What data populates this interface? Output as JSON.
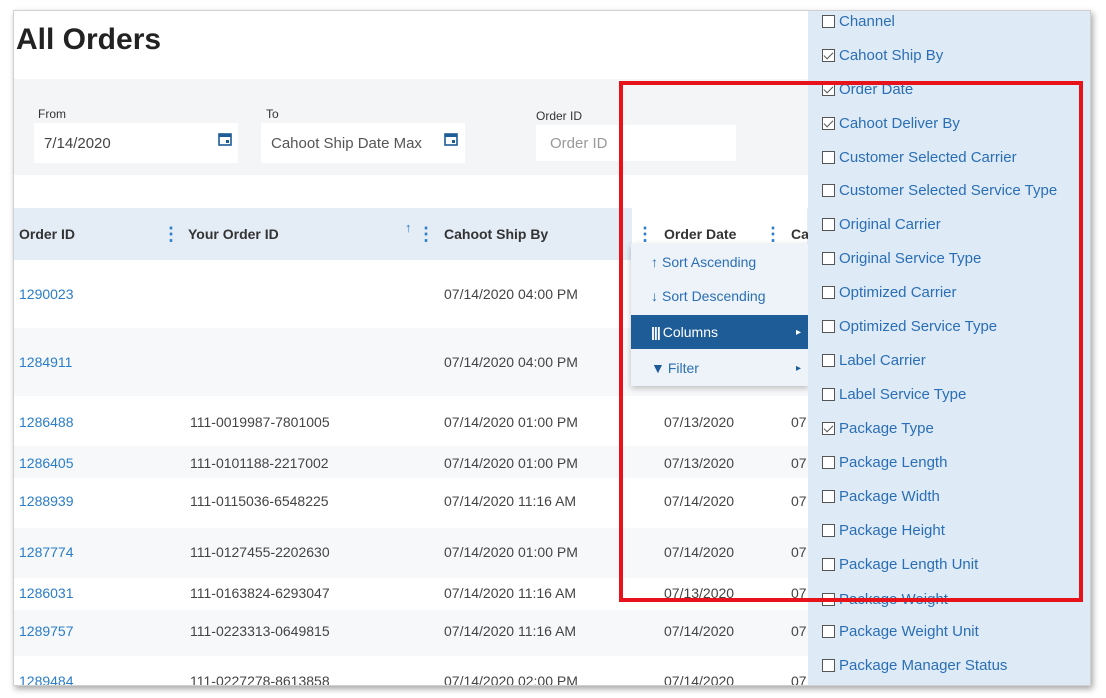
{
  "page": {
    "title": "All Orders"
  },
  "filters": {
    "from_label": "From",
    "from_value": "7/14/2020",
    "to_label": "To",
    "to_placeholder": "Cahoot Ship Date Max",
    "order_id_label": "Order ID",
    "order_id_placeholder": "Order ID"
  },
  "grid": {
    "headers": {
      "order_id": "Order ID",
      "your_order_id": "Your Order ID",
      "cahoot_ship_by": "Cahoot Ship By",
      "order_date": "Order Date",
      "next_partial": "Ca"
    },
    "sort_indicator": "↑",
    "rows": [
      {
        "order_id": "1290023",
        "your_order_id": "",
        "ship_by": "07/14/2020 04:00 PM",
        "order_date": "",
        "extra": ""
      },
      {
        "order_id": "1284911",
        "your_order_id": "",
        "ship_by": "07/14/2020 04:00 PM",
        "order_date": "",
        "extra": ""
      },
      {
        "order_id": "1286488",
        "your_order_id": "111-0019987-7801005",
        "ship_by": "07/14/2020 01:00 PM",
        "order_date": "07/13/2020",
        "extra": "07"
      },
      {
        "order_id": "1286405",
        "your_order_id": "111-0101188-2217002",
        "ship_by": "07/14/2020 01:00 PM",
        "order_date": "07/13/2020",
        "extra": "07"
      },
      {
        "order_id": "1288939",
        "your_order_id": "111-0115036-6548225",
        "ship_by": "07/14/2020 11:16 AM",
        "order_date": "07/14/2020",
        "extra": "07"
      },
      {
        "order_id": "1287774",
        "your_order_id": "111-0127455-2202630",
        "ship_by": "07/14/2020 01:00 PM",
        "order_date": "07/14/2020",
        "extra": "07"
      },
      {
        "order_id": "1286031",
        "your_order_id": "111-0163824-6293047",
        "ship_by": "07/14/2020 11:16 AM",
        "order_date": "07/13/2020",
        "extra": "07"
      },
      {
        "order_id": "1289757",
        "your_order_id": "111-0223313-0649815",
        "ship_by": "07/14/2020 11:16 AM",
        "order_date": "07/14/2020",
        "extra": "07"
      },
      {
        "order_id": "1289484",
        "your_order_id": "111-0227278-8613858",
        "ship_by": "07/14/2020 02:00 PM",
        "order_date": "07/14/2020",
        "extra": "07"
      }
    ]
  },
  "context_menu": {
    "sort_ascending": "Sort Ascending",
    "sort_descending": "Sort Descending",
    "columns": "Columns",
    "filter": "Filter",
    "submenu_arrow": "▸"
  },
  "columns_panel": {
    "options": [
      {
        "label": "Channel",
        "checked": false
      },
      {
        "label": "Cahoot Ship By",
        "checked": true
      },
      {
        "label": "Order Date",
        "checked": true
      },
      {
        "label": "Cahoot Deliver By",
        "checked": true
      },
      {
        "label": "Customer Selected Carrier",
        "checked": false
      },
      {
        "label": "Customer Selected Service Type",
        "checked": false
      },
      {
        "label": "Original Carrier",
        "checked": false
      },
      {
        "label": "Original Service Type",
        "checked": false
      },
      {
        "label": "Optimized Carrier",
        "checked": false
      },
      {
        "label": "Optimized Service Type",
        "checked": false
      },
      {
        "label": "Label Carrier",
        "checked": false
      },
      {
        "label": "Label Service Type",
        "checked": false
      },
      {
        "label": "Package Type",
        "checked": true
      },
      {
        "label": "Package Length",
        "checked": false
      },
      {
        "label": "Package Width",
        "checked": false
      },
      {
        "label": "Package Height",
        "checked": false
      },
      {
        "label": "Package Length Unit",
        "checked": false
      },
      {
        "label": "Package Weight",
        "checked": false
      },
      {
        "label": "Package Weight Unit",
        "checked": false
      },
      {
        "label": "Package Manager Status",
        "checked": false
      }
    ]
  },
  "colors": {
    "link": "#2a7dc9",
    "menu_active": "#1d5c96",
    "header_bg": "#e4ecf5",
    "panel_bg": "#dfeaf7",
    "highlight": "#e8121a"
  },
  "icons": {
    "calendar": "calendar-icon",
    "columns": "columns-icon",
    "filter": "filter-icon",
    "kebab": "kebab-menu-icon"
  }
}
